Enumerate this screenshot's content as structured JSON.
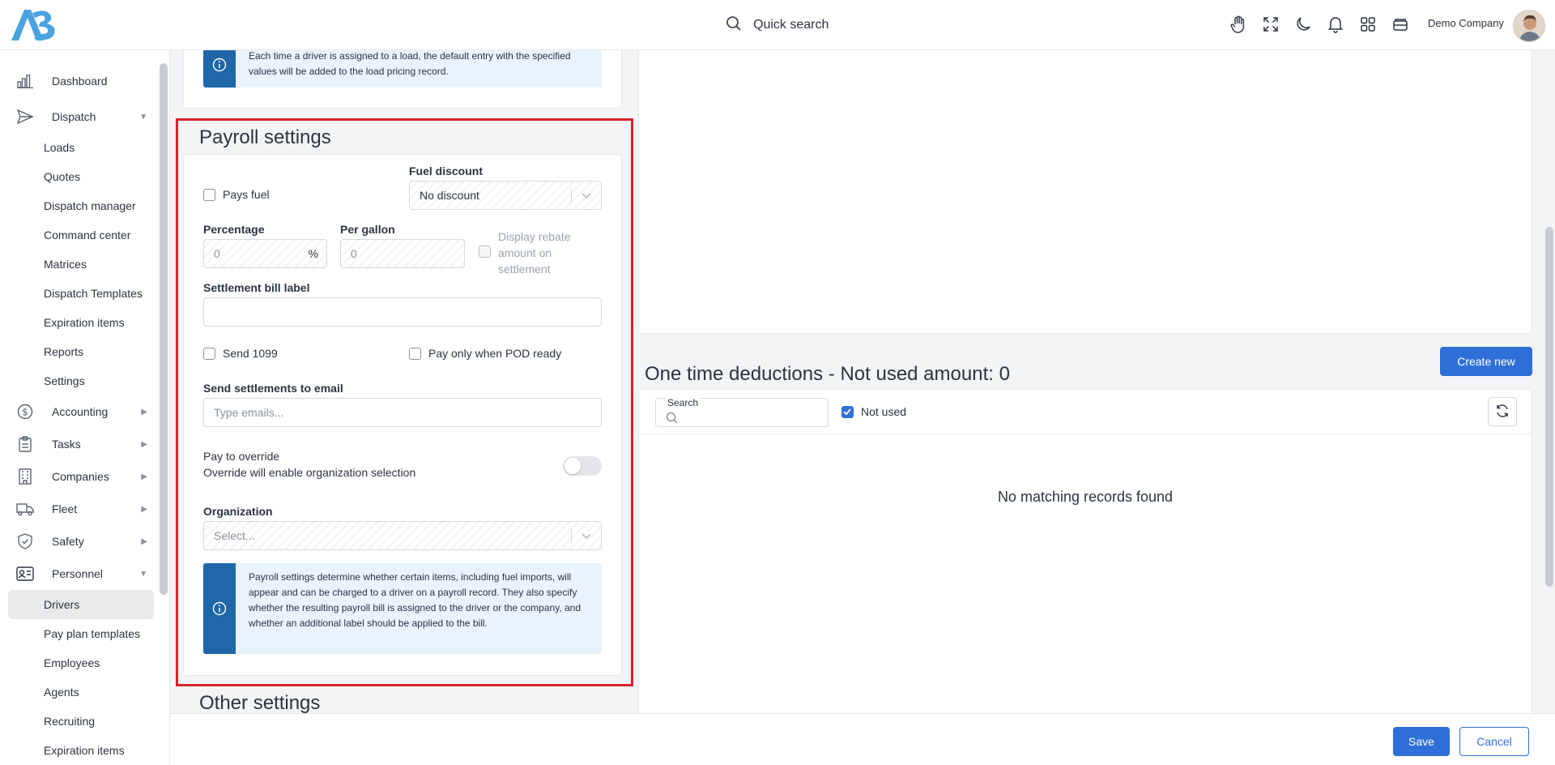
{
  "header": {
    "quick_search": "Quick search",
    "company": "Demo Company",
    "icons": [
      "hand-icon",
      "fullscreen-icon",
      "moon-icon",
      "bell-icon",
      "apps-grid-icon",
      "inbox-icon"
    ]
  },
  "sidebar": {
    "dashboard": "Dashboard",
    "dispatch": "Dispatch",
    "dispatch_items": [
      "Loads",
      "Quotes",
      "Dispatch manager",
      "Command center",
      "Matrices",
      "Dispatch Templates",
      "Expiration items",
      "Reports",
      "Settings"
    ],
    "accounting": "Accounting",
    "tasks": "Tasks",
    "companies": "Companies",
    "fleet": "Fleet",
    "safety": "Safety",
    "personnel": "Personnel",
    "personnel_items": [
      "Drivers",
      "Pay plan templates",
      "Employees",
      "Agents",
      "Recruiting",
      "Expiration items"
    ],
    "active_item": "Drivers"
  },
  "top_info": {
    "text": "Each time a driver is assigned to a load, the default entry with the specified values will be added to the load pricing record."
  },
  "payroll": {
    "title": "Payroll settings",
    "pays_fuel": "Pays fuel",
    "fuel_discount_label": "Fuel discount",
    "fuel_discount_value": "No discount",
    "percentage_label": "Percentage",
    "percentage_placeholder": "0",
    "percentage_unit": "%",
    "per_gallon_label": "Per gallon",
    "per_gallon_placeholder": "0",
    "display_rebate": "Display rebate amount on settlement",
    "settlement_bill_label": "Settlement bill label",
    "settlement_bill_value": "",
    "send_1099": "Send 1099",
    "pay_only_pod": "Pay only when POD ready",
    "send_email_label": "Send settlements to email",
    "send_email_placeholder": "Type emails...",
    "pay_override_title": "Pay to override",
    "pay_override_desc": "Override will enable organization selection",
    "organization_label": "Organization",
    "organization_placeholder": "Select...",
    "info_text": "Payroll settings determine whether certain items, including fuel imports, will appear and can be charged to a driver on a payroll record. They also specify whether the resulting payroll bill is assigned to the driver or the company, and whether an additional label should be applied to the bill."
  },
  "other_settings": {
    "title": "Other settings"
  },
  "deductions": {
    "title": "One time deductions - Not used amount: 0",
    "create_new": "Create new",
    "search_label": "Search",
    "not_used": "Not used",
    "not_used_checked": true,
    "empty": "No matching records found"
  },
  "footer": {
    "save": "Save",
    "cancel": "Cancel"
  },
  "colors": {
    "primary": "#2f6fd8",
    "highlight_border": "#d9232a",
    "info_bar": "#1f67a8",
    "info_bg": "#e8f3fd"
  }
}
